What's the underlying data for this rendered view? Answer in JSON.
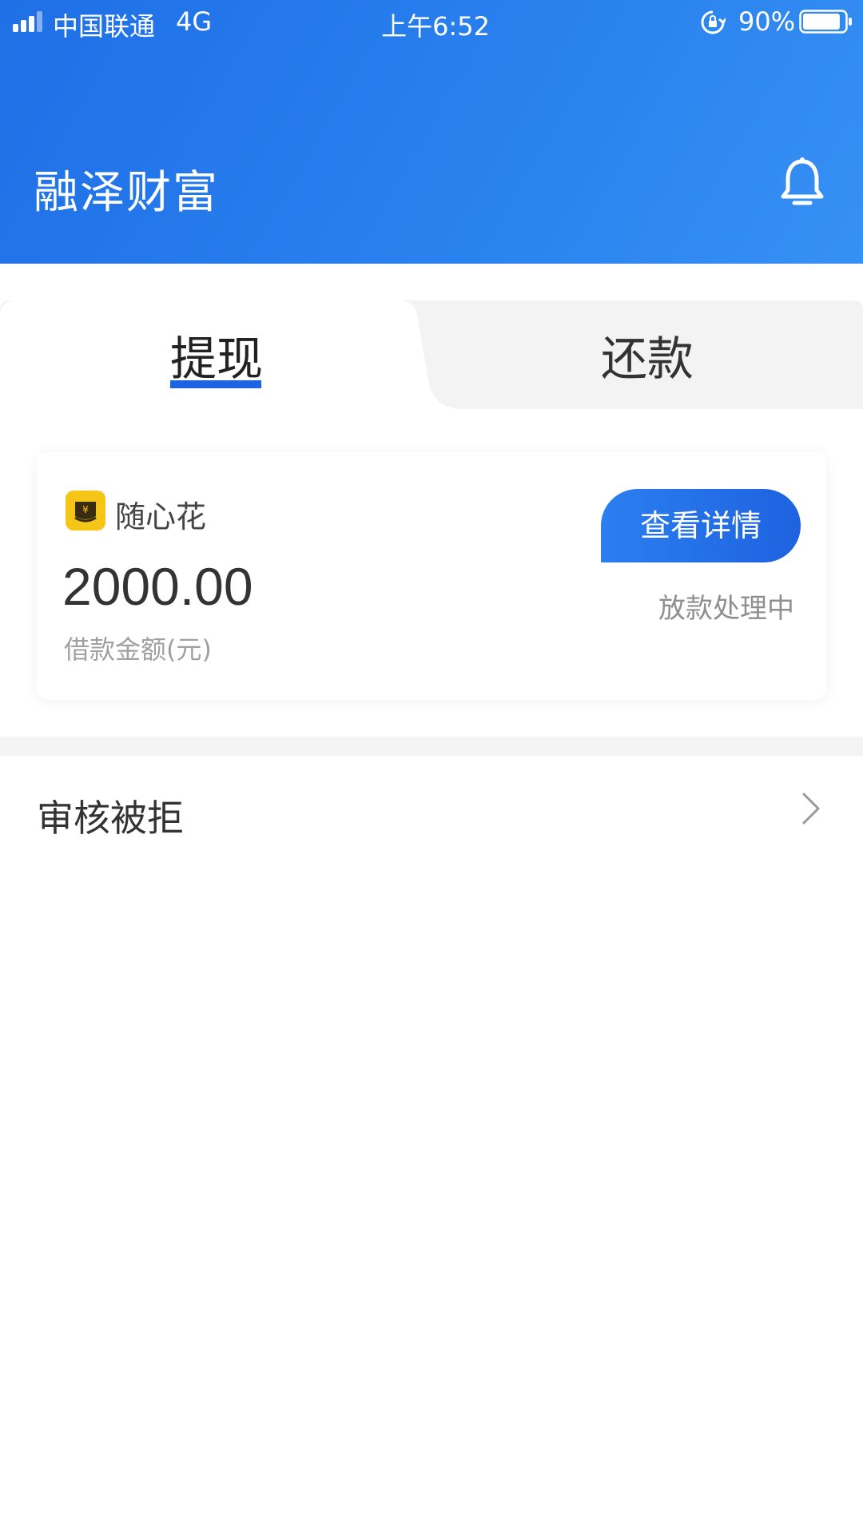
{
  "status_bar": {
    "carrier": "中国联通",
    "network": "4G",
    "time": "上午6:52",
    "battery": "90%",
    "battery_level": 0.9
  },
  "header": {
    "title": "融泽财富",
    "notification_icon": "bell-icon"
  },
  "tabs": [
    {
      "label": "提现",
      "active": true
    },
    {
      "label": "还款",
      "active": false
    }
  ],
  "loan_card": {
    "product_icon": "wallet-icon",
    "product_name": "随心花",
    "amount": "2000.00",
    "amount_label": "借款金额(元)",
    "detail_button_label": "查看详情",
    "status": "放款处理中"
  },
  "list": {
    "rejected_label": "审核被拒",
    "chevron_icon": "chevron-right-icon"
  },
  "colors": {
    "header_gradient_start": "#1f6fe6",
    "header_gradient_end": "#3790f3",
    "accent": "#1d64e3",
    "product_icon_bg": "#f5c518"
  }
}
